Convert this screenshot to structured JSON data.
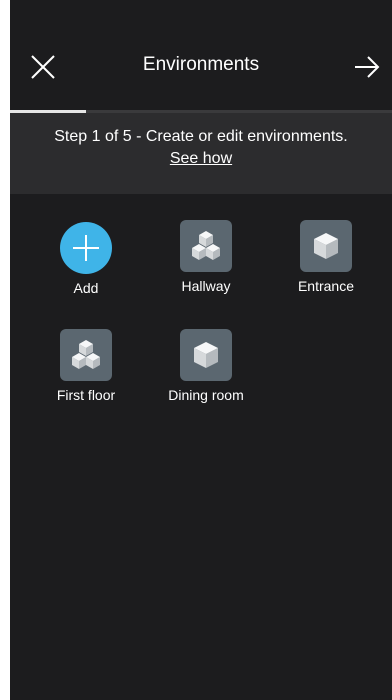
{
  "header": {
    "title": "Environments",
    "close_icon": "close-icon",
    "next_icon": "arrow-right-icon"
  },
  "progress": {
    "current_step": 1,
    "total_steps": 5,
    "fraction": 0.2
  },
  "banner": {
    "text": "Step 1 of 5 - Create or edit environments.",
    "link": "See how"
  },
  "environments": [
    {
      "label": "Add",
      "icon": "plus-icon"
    },
    {
      "label": "Hallway",
      "icon": "cubes-icon"
    },
    {
      "label": "Entrance",
      "icon": "cube-icon"
    },
    {
      "label": "First floor",
      "icon": "cubes-icon"
    },
    {
      "label": "Dining room",
      "icon": "cube-icon"
    }
  ],
  "colors": {
    "background": "#1c1c1e",
    "banner": "#2c2c2e",
    "accent": "#3fb4e8",
    "tile": "#5b6770"
  }
}
